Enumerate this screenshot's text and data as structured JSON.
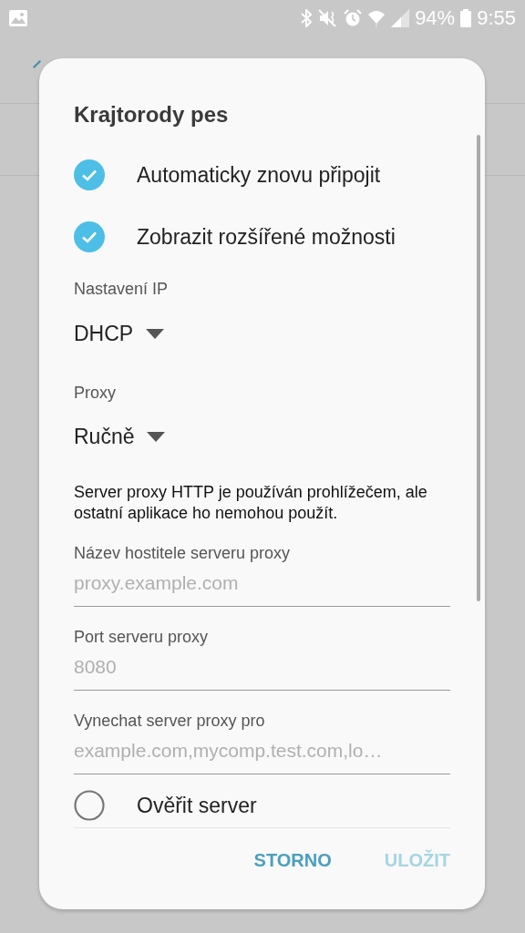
{
  "status_bar": {
    "battery": "94%",
    "time": "9:55"
  },
  "dialog": {
    "title": "Krajtorody pes",
    "options": [
      {
        "kind": "checkbox",
        "label": "Automaticky znovu připojit",
        "checked": true
      },
      {
        "kind": "checkbox",
        "label": "Zobrazit rozšířené možnosti",
        "checked": true
      }
    ],
    "ip_settings": {
      "label": "Nastavení IP",
      "value": "DHCP"
    },
    "proxy": {
      "label": "Proxy",
      "value": "Ručně"
    },
    "proxy_note": "Server proxy HTTP je používán prohlížečem, ale ostatní aplikace ho nemohou použít.",
    "fields": [
      {
        "label": "Název hostitele serveru proxy",
        "placeholder": "proxy.example.com"
      },
      {
        "label": "Port serveru proxy",
        "placeholder": "8080"
      },
      {
        "label": "Vynechat server proxy pro",
        "placeholder": "example.com,mycomp.test.com,lo…"
      }
    ],
    "verify_server": {
      "label": "Ověřit server",
      "checked": false
    },
    "buttons": [
      {
        "label": "STORNO",
        "disabled": false
      },
      {
        "label": "ULOŽIT",
        "disabled": true
      }
    ]
  }
}
